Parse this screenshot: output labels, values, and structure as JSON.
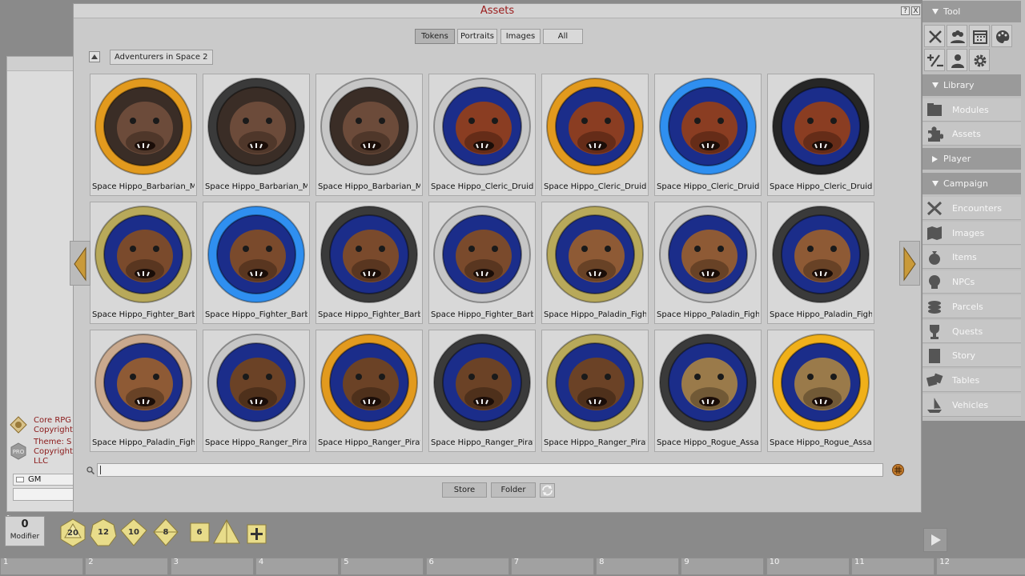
{
  "chat": {
    "messages": [
      {
        "lines": [
          "Core RPG",
          "Copyright"
        ],
        "icon": "ruleset-icon"
      },
      {
        "lines": [
          "Theme: S",
          "Copyright",
          "LLC"
        ],
        "icon": "pro-badge-icon"
      }
    ],
    "identity": "GM"
  },
  "assets": {
    "title": "Assets",
    "help": "?",
    "close": "X",
    "tabs": [
      "Tokens",
      "Portraits",
      "Images",
      "All"
    ],
    "active_tab": "Tokens",
    "folder": "Adventurers in Space 2",
    "tokens": [
      {
        "label": "Space Hippo_Barbarian_Mo",
        "ring": "#e29a1e",
        "skin": "#6c4b3a",
        "bg": "#3a2d26"
      },
      {
        "label": "Space Hippo_Barbarian_Mo",
        "ring": "#3a3a3a",
        "skin": "#6c4b3a",
        "bg": "#3a2d26"
      },
      {
        "label": "Space Hippo_Barbarian_Mo",
        "ring": "#c6c6c6",
        "skin": "#6c4b3a",
        "bg": "#3a2d26"
      },
      {
        "label": "Space Hippo_Cleric_Druid_V",
        "ring": "#c6c6c6",
        "skin": "#8a3d22",
        "bg": "#1b2d8a"
      },
      {
        "label": "Space Hippo_Cleric_Druid_V",
        "ring": "#e29a1e",
        "skin": "#8a3d22",
        "bg": "#1b2d8a"
      },
      {
        "label": "Space Hippo_Cleric_Druid_V",
        "ring": "#2f8ff0",
        "skin": "#8a3d22",
        "bg": "#1b2d8a"
      },
      {
        "label": "Space Hippo_Cleric_Druid_V",
        "ring": "#262626",
        "skin": "#8a3d22",
        "bg": "#1b2d8a"
      },
      {
        "label": "Space Hippo_Fighter_Barba",
        "ring": "#b8a95a",
        "skin": "#7a4a2c",
        "bg": "#1b2d8a"
      },
      {
        "label": "Space Hippo_Fighter_Barba",
        "ring": "#2f8ff0",
        "skin": "#7a4a2c",
        "bg": "#1b2d8a"
      },
      {
        "label": "Space Hippo_Fighter_Barba",
        "ring": "#3a3a3a",
        "skin": "#7a4a2c",
        "bg": "#1b2d8a"
      },
      {
        "label": "Space Hippo_Fighter_Barba",
        "ring": "#c6c6c6",
        "skin": "#7a4a2c",
        "bg": "#1b2d8a"
      },
      {
        "label": "Space Hippo_Paladin_Fight",
        "ring": "#b8a95a",
        "skin": "#8e5a35",
        "bg": "#1b2d8a"
      },
      {
        "label": "Space Hippo_Paladin_Fight",
        "ring": "#c6c6c6",
        "skin": "#8e5a35",
        "bg": "#1b2d8a"
      },
      {
        "label": "Space Hippo_Paladin_Fight",
        "ring": "#3a3a3a",
        "skin": "#8e5a35",
        "bg": "#1b2d8a"
      },
      {
        "label": "Space Hippo_Paladin_Fight",
        "ring": "#c9a98e",
        "skin": "#8e5a35",
        "bg": "#1b2d8a"
      },
      {
        "label": "Space Hippo_Ranger_Pirate",
        "ring": "#c6c6c6",
        "skin": "#6b4226",
        "bg": "#1b2d8a"
      },
      {
        "label": "Space Hippo_Ranger_Pirate",
        "ring": "#e29a1e",
        "skin": "#6b4226",
        "bg": "#1b2d8a"
      },
      {
        "label": "Space Hippo_Ranger_Pirate",
        "ring": "#3a3a3a",
        "skin": "#6b4226",
        "bg": "#1b2d8a"
      },
      {
        "label": "Space Hippo_Ranger_Pirate",
        "ring": "#b8a95a",
        "skin": "#6b4226",
        "bg": "#1b2d8a"
      },
      {
        "label": "Space Hippo_Rogue_Assass",
        "ring": "#3a3a3a",
        "skin": "#9a7a4a",
        "bg": "#1b2d8a"
      },
      {
        "label": "Space Hippo_Rogue_Assass",
        "ring": "#f0b01a",
        "skin": "#9a7a4a",
        "bg": "#1b2d8a"
      }
    ],
    "prev": "previous-page",
    "next": "next-page",
    "store": "Store",
    "folder_button": "Folder"
  },
  "sidebar": {
    "tool_header": "Tool",
    "tool_icons": [
      "combat-tracker-icon",
      "party-sheet-icon",
      "calendar-icon",
      "color-palette-icon",
      "modifiers-icon",
      "character-select-icon",
      "options-gear-icon"
    ],
    "library_header": "Library",
    "library_items": [
      {
        "label": "Modules",
        "icon": "modules-icon"
      },
      {
        "label": "Assets",
        "icon": "assets-puzzle-icon"
      }
    ],
    "player_header": "Player",
    "campaign_header": "Campaign",
    "campaign_items": [
      {
        "label": "Encounters",
        "icon": "crossed-swords-icon"
      },
      {
        "label": "Images",
        "icon": "map-icon"
      },
      {
        "label": "Items",
        "icon": "pouch-icon"
      },
      {
        "label": "NPCs",
        "icon": "skull-icon"
      },
      {
        "label": "Parcels",
        "icon": "coins-icon"
      },
      {
        "label": "Quests",
        "icon": "trophy-icon"
      },
      {
        "label": "Story",
        "icon": "book-icon"
      },
      {
        "label": "Tables",
        "icon": "dice-icon"
      },
      {
        "label": "Vehicles",
        "icon": "ship-icon"
      }
    ]
  },
  "bottom": {
    "modifier_value": "0",
    "modifier_label": "Modifier",
    "dice": [
      "20",
      "12",
      "10",
      "8",
      "6",
      "4"
    ],
    "hotkeys": [
      "1",
      "2",
      "3",
      "4",
      "5",
      "6",
      "7",
      "8",
      "9",
      "10",
      "11",
      "12"
    ]
  }
}
